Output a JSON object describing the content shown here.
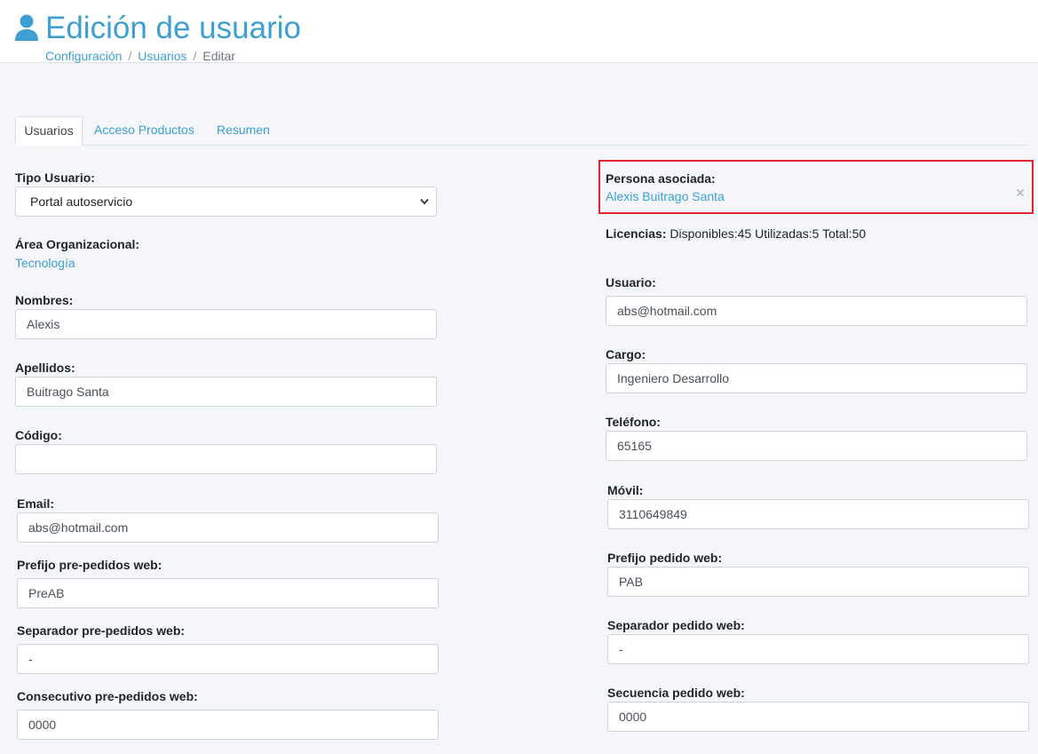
{
  "header": {
    "title": "Edición de usuario",
    "breadcrumb": [
      "Configuración",
      "Usuarios",
      "Editar"
    ]
  },
  "tabs": [
    {
      "label": "Usuarios",
      "active": true
    },
    {
      "label": "Acceso Productos",
      "active": false
    },
    {
      "label": "Resumen",
      "active": false
    }
  ],
  "left": {
    "tipo_usuario": {
      "label": "Tipo Usuario:",
      "value": "Portal autoservicio"
    },
    "area": {
      "label": "Área Organizacional:",
      "value": "Tecnología"
    },
    "nombres": {
      "label": "Nombres:",
      "value": "Alexis"
    },
    "apellidos": {
      "label": "Apellidos:",
      "value": "Buitrago Santa"
    },
    "codigo": {
      "label": "Código:",
      "value": ""
    },
    "email": {
      "label": "Email:",
      "value": "abs@hotmail.com"
    },
    "prefijo_pre": {
      "label": "Prefijo pre-pedidos web:",
      "value": "PreAB"
    },
    "separador_pre": {
      "label": "Separador pre-pedidos web:",
      "value": "-"
    },
    "consecutivo_pre": {
      "label": "Consecutivo pre-pedidos web:",
      "value": "0000"
    }
  },
  "right": {
    "persona": {
      "label": "Persona asociada:",
      "value": "Alexis Buitrago Santa",
      "clear": "×"
    },
    "licencias": {
      "label": "Licencias:",
      "text": "Disponibles:45 Utilizadas:5 Total:50"
    },
    "usuario": {
      "label": "Usuario:",
      "value": "abs@hotmail.com"
    },
    "cargo": {
      "label": "Cargo:",
      "value": "Ingeniero Desarrollo"
    },
    "telefono": {
      "label": "Teléfono:",
      "value": "65165"
    },
    "movil": {
      "label": "Móvil:",
      "value": "3110649849"
    },
    "prefijo": {
      "label": "Prefijo pedido web:",
      "value": "PAB"
    },
    "separador": {
      "label": "Separador pedido web:",
      "value": "-"
    },
    "secuencia": {
      "label": "Secuencia pedido web:",
      "value": "0000"
    }
  },
  "colors": {
    "accent": "#3d9fd2",
    "highlight": "#e3222b"
  }
}
